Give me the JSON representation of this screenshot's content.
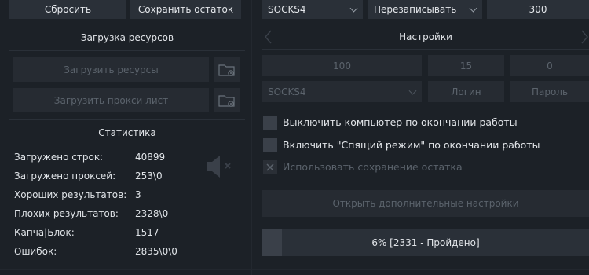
{
  "left": {
    "reset_label": "Сбросить",
    "save_rest_label": "Сохранить остаток",
    "resources_title": "Загрузка ресурсов",
    "load_resources_label": "Загрузить ресурсы",
    "load_proxy_label": "Загрузить прокси лист",
    "stats_title": "Статистика",
    "stats": [
      {
        "label": "Загружено строк:",
        "value": "40899"
      },
      {
        "label": "Загружено проксей:",
        "value": "253\\0"
      },
      {
        "label": "Хороших результатов:",
        "value": "3"
      },
      {
        "label": "Плохих результатов:",
        "value": "2328\\0"
      },
      {
        "label": "Капча|Блок:",
        "value": "1517"
      },
      {
        "label": "Ошибок:",
        "value": "2835\\0\\0"
      }
    ]
  },
  "right": {
    "proxy_type": "SOCKS4",
    "write_mode": "Перезаписывать",
    "threads": "300",
    "settings_title": "Настройки",
    "field_1": "100",
    "field_2": "15",
    "field_3": "0",
    "proxy_type_2": "SOCKS4",
    "login_placeholder": "Логин",
    "password_placeholder": "Пароль",
    "checks": [
      {
        "label": "Выключить компьютер по окончании работы"
      },
      {
        "label": "Включить \"Спящий режим\" по окончании работы"
      },
      {
        "label": "Использовать сохранение остатка"
      }
    ],
    "extra_settings_label": "Открыть дополнительные настройки",
    "progress_text": "6% [2331 - Пройдено]",
    "progress_percent": 6
  },
  "colors": {
    "background": "#1c2127",
    "button": "#2a3038",
    "progress_fill": "#3a4049"
  }
}
